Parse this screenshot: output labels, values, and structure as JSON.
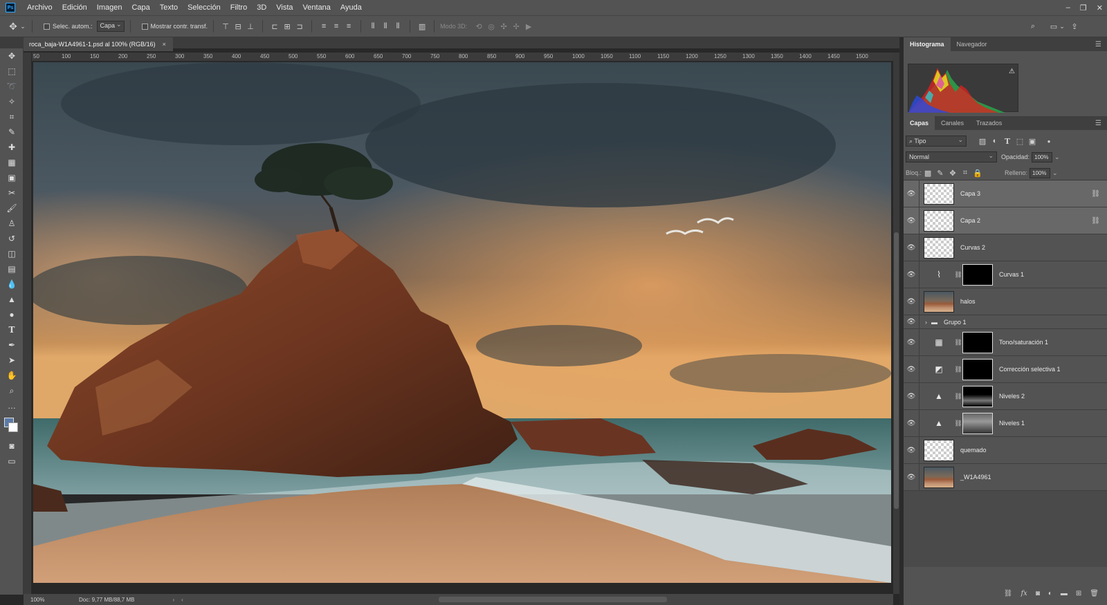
{
  "app": {
    "logo": "Ps"
  },
  "menu": [
    "Archivo",
    "Edición",
    "Imagen",
    "Capa",
    "Texto",
    "Selección",
    "Filtro",
    "3D",
    "Vista",
    "Ventana",
    "Ayuda"
  ],
  "window_controls": [
    "–",
    "❐",
    "✕"
  ],
  "options": {
    "auto_select_label": "Selec. autom.:",
    "auto_select_target": "Capa",
    "show_transform_label": "Mostrar contr. transf.",
    "mode_3d_label": "Modo 3D:"
  },
  "document": {
    "tab_title": "roca_baja-W1A4961-1.psd al 100% (RGB/16)",
    "zoom": "100%",
    "doc_size": "Doc: 9,77 MB/88,7 MB"
  },
  "ruler_ticks": [
    "50",
    "100",
    "150",
    "200",
    "250",
    "300",
    "350",
    "400",
    "450",
    "500",
    "550",
    "600",
    "650",
    "700",
    "750",
    "800",
    "850",
    "900",
    "950",
    "1000",
    "1050",
    "1100",
    "1150",
    "1200",
    "1250",
    "1300",
    "1350",
    "1400",
    "1450",
    "1500"
  ],
  "panels": {
    "top_tabs": [
      "Histograma",
      "Navegador"
    ],
    "layers_tabs": [
      "Capas",
      "Canales",
      "Trazados"
    ],
    "filter_kind": "Tipo",
    "blend_mode": "Normal",
    "opacity_label": "Opacidad:",
    "opacity_value": "100%",
    "lock_label": "Bloq.:",
    "fill_label": "Relleno:",
    "fill_value": "100%"
  },
  "layers": [
    {
      "name": "Capa 3",
      "kind": "empty",
      "selected": true,
      "linked": true
    },
    {
      "name": "Capa 2",
      "kind": "empty",
      "selected": true,
      "linked": true
    },
    {
      "name": "Curvas 2",
      "kind": "empty",
      "selected": false
    },
    {
      "name": "Curvas 1",
      "kind": "adjust",
      "icon": "curves-icon",
      "selected": false
    },
    {
      "name": "halos",
      "kind": "photo",
      "selected": false
    },
    {
      "name": "Grupo 1",
      "kind": "group",
      "selected": false
    },
    {
      "name": "Tono/saturación 1",
      "kind": "adjust",
      "icon": "hue-saturation-icon",
      "selected": false
    },
    {
      "name": "Corrección selectiva 1",
      "kind": "adjust",
      "icon": "selective-color-icon",
      "selected": false
    },
    {
      "name": "Niveles 2",
      "kind": "adjust",
      "icon": "levels-icon",
      "selected": false
    },
    {
      "name": "Niveles 1",
      "kind": "adjust",
      "icon": "levels-icon",
      "selected": false
    },
    {
      "name": "quemado",
      "kind": "empty",
      "selected": false
    },
    {
      "name": "_W1A4961",
      "kind": "photo",
      "selected": false
    }
  ]
}
